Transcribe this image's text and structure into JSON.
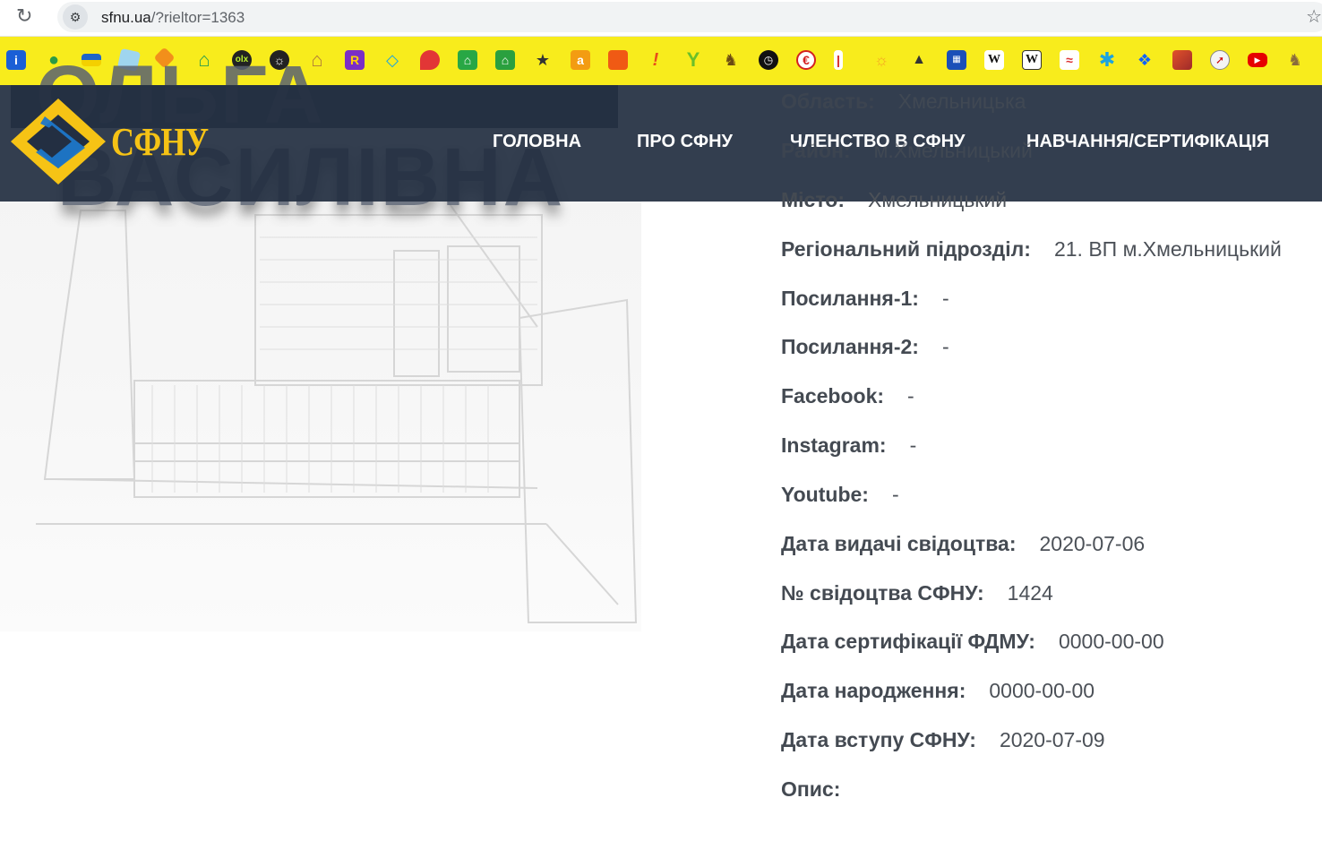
{
  "browser": {
    "url_host": "sfnu.ua",
    "url_path": "/?rieltor=1363",
    "bookmark_icons": [
      "info-icon",
      "maps-pin-icon",
      "ukraine-flag-icon",
      "map-icon",
      "orange-gem-icon",
      "house-icon",
      "olx-icon",
      "globe-icon",
      "house-outline-icon",
      "r-icon",
      "diamond-icon",
      "location-pin-icon",
      "green-house-icon",
      "yellow-house-icon",
      "chat-icon",
      "a-icon",
      "cube-icon",
      "exclamation-icon",
      "y-icon",
      "dog-icon",
      "clock-icon",
      "e-icon",
      "thermometer-icon",
      "weather-icon",
      "hat-icon",
      "grid-icon",
      "wiki-icon",
      "wiki-box-icon",
      "chart-icon",
      "snowflake-icon",
      "dropbox-icon",
      "chart-red-icon",
      "compass-icon",
      "youtube-icon",
      "horse-icon"
    ]
  },
  "header": {
    "logo_text": "СФНУ",
    "nav": [
      {
        "label": "ГОЛОВНА"
      },
      {
        "label": "ПРО СФНУ"
      },
      {
        "label": "ЧЛЕНСТВО В СФНУ"
      },
      {
        "label": "НАВЧАННЯ/СЕРТИФІКАЦІЯ"
      }
    ]
  },
  "hero": {
    "name_line1": "ОЛЬГА",
    "name_line2": "ВАСИЛІВНА"
  },
  "details": {
    "oblast_label": "Область:",
    "oblast_value": "Хмельницька",
    "rayon_label": "Район:",
    "rayon_value": "м.Хмельницький",
    "misto_label": "Місто:",
    "misto_value": "Хмельницький",
    "region_label": "Регіональний підрозділ:",
    "region_value": "21. ВП м.Хмельницький",
    "link1_label": "Посилання-1:",
    "link1_value": "-",
    "link2_label": "Посилання-2:",
    "link2_value": "-",
    "facebook_label": "Facebook:",
    "facebook_value": "-",
    "instagram_label": "Instagram:",
    "instagram_value": "-",
    "youtube_label": "Youtube:",
    "youtube_value": "-",
    "cert_date_label": "Дата видачі свідоцтва:",
    "cert_date_value": "2020-07-06",
    "cert_no_label": "№ свідоцтва СФНУ:",
    "cert_no_value": "1424",
    "fdmu_label": "Дата сертифікації ФДМУ:",
    "fdmu_value": "0000-00-00",
    "birth_label": "Дата народження:",
    "birth_value": "0000-00-00",
    "join_label": "Дата вступу СФНУ:",
    "join_value": "2020-07-09",
    "desc_label": "Опис:"
  },
  "colors": {
    "navbar": "#232f42",
    "bookmarks_bar": "#f8ec1c",
    "logo_yellow": "#f6c315",
    "logo_blue": "#1e77c9"
  }
}
